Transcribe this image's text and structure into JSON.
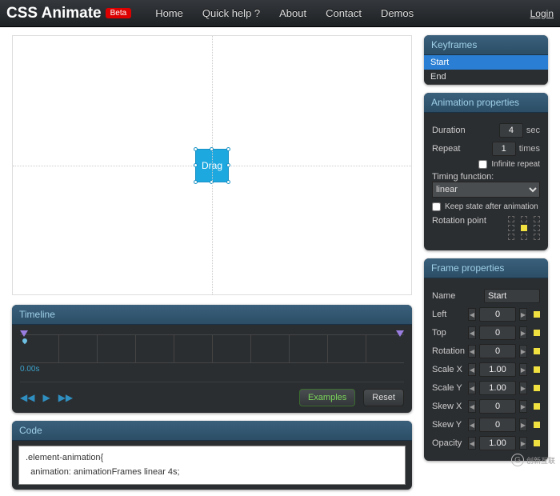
{
  "header": {
    "logo": "CSS Animate",
    "badge": "Beta",
    "nav": [
      "Home",
      "Quick help ?",
      "About",
      "Contact",
      "Demos"
    ],
    "login": "Login"
  },
  "canvas": {
    "drag_label": "Drag"
  },
  "timeline": {
    "title": "Timeline",
    "time": "0.00s",
    "examples": "Examples",
    "reset": "Reset"
  },
  "code": {
    "title": "Code",
    "line1": ".element-animation{",
    "line2": "  animation: animationFrames linear 4s;"
  },
  "keyframes": {
    "title": "Keyframes",
    "items": [
      "Start",
      "End"
    ],
    "selected": 0
  },
  "anim": {
    "title": "Animation properties",
    "duration_label": "Duration",
    "duration_val": "4",
    "duration_unit": "sec",
    "repeat_label": "Repeat",
    "repeat_val": "1",
    "repeat_unit": "times",
    "infinite": "Infinite repeat",
    "timing_label": "Timing function:",
    "timing_val": "linear",
    "keep_state": "Keep state after animation",
    "rotation_point": "Rotation point"
  },
  "frame": {
    "title": "Frame properties",
    "name_label": "Name",
    "name_val": "Start",
    "rows": [
      {
        "label": "Left",
        "val": "0"
      },
      {
        "label": "Top",
        "val": "0"
      },
      {
        "label": "Rotation",
        "val": "0"
      },
      {
        "label": "Scale X",
        "val": "1.00"
      },
      {
        "label": "Scale Y",
        "val": "1.00"
      },
      {
        "label": "Skew X",
        "val": "0"
      },
      {
        "label": "Skew Y",
        "val": "0"
      },
      {
        "label": "Opacity",
        "val": "1.00"
      }
    ]
  },
  "watermark": "创新互联"
}
